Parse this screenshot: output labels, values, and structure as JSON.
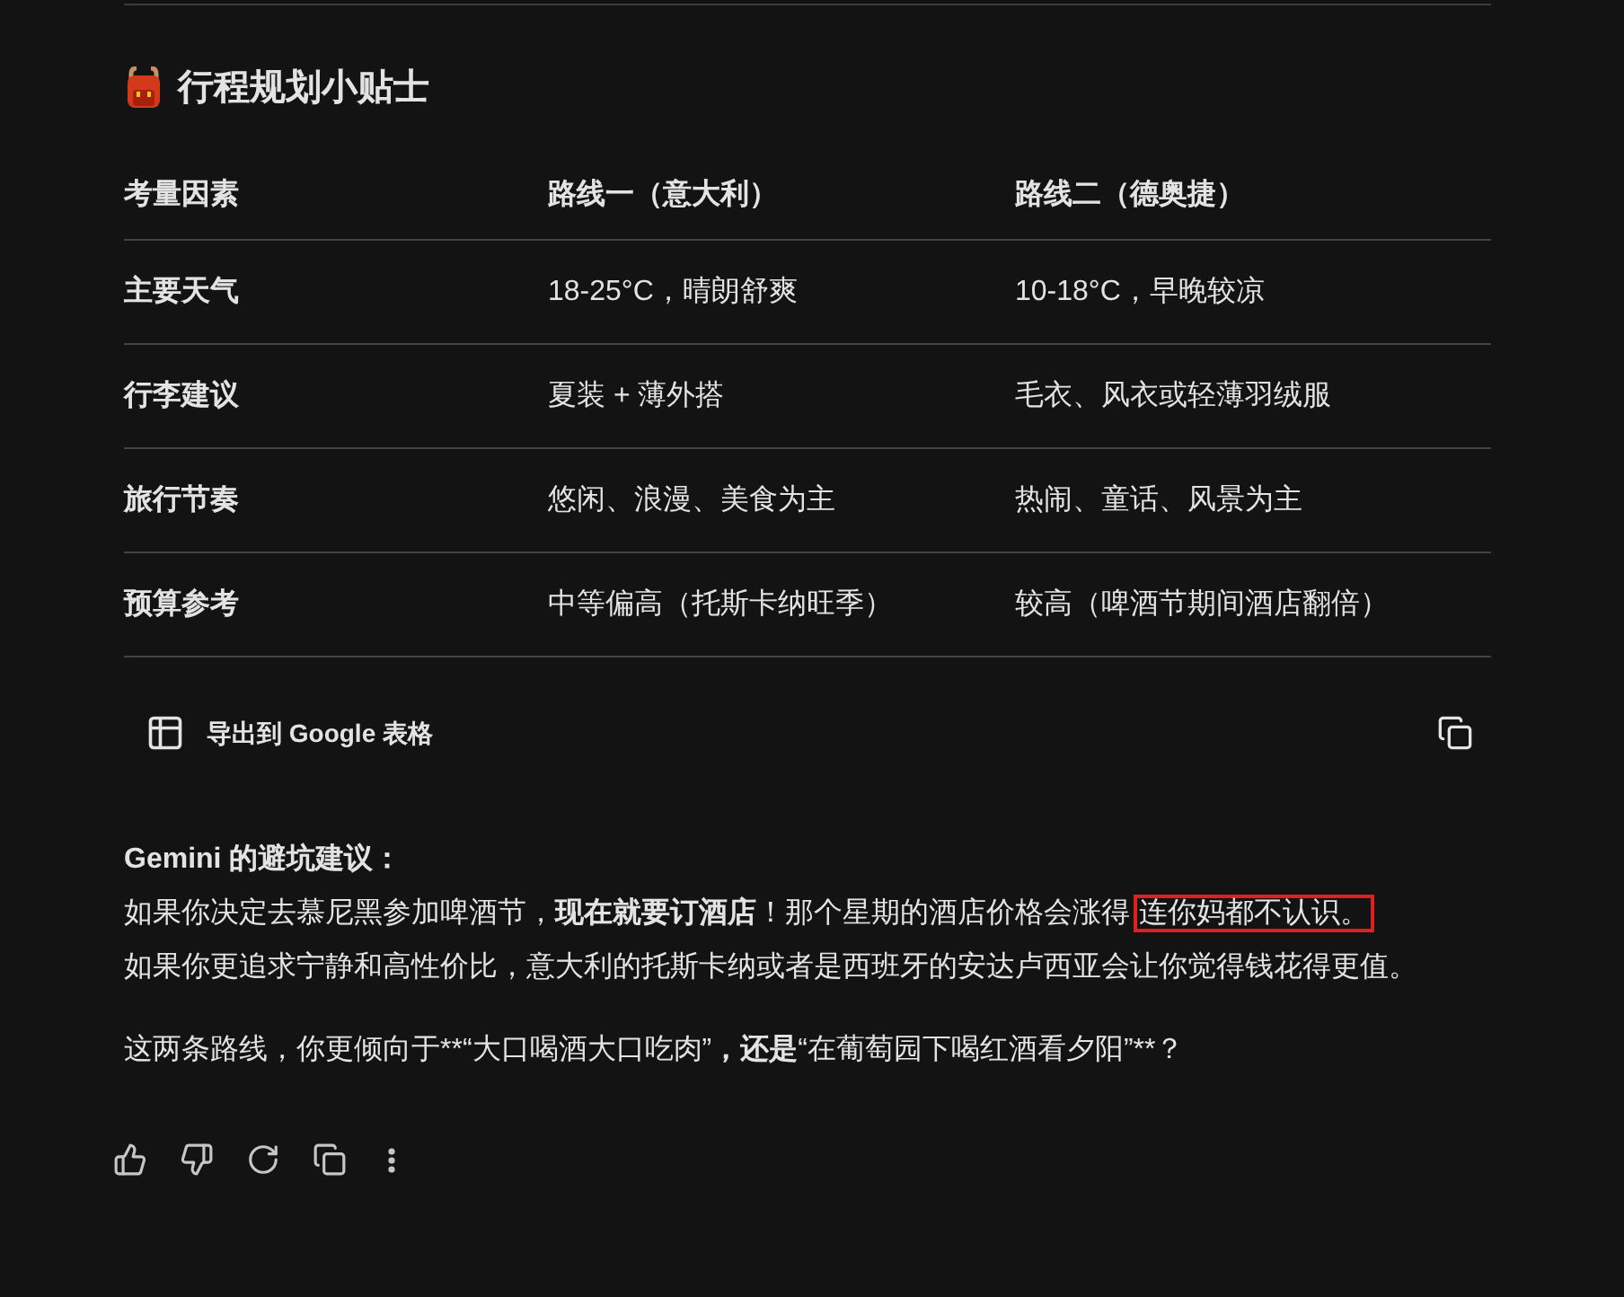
{
  "heading": {
    "title": "行程规划小贴士"
  },
  "table": {
    "columns": [
      "考量因素",
      "路线一（意大利）",
      "路线二（德奥捷）"
    ],
    "rows": [
      [
        "主要天气",
        "18-25°C，晴朗舒爽",
        "10-18°C，早晚较凉"
      ],
      [
        "行李建议",
        "夏装 + 薄外搭",
        "毛衣、风衣或轻薄羽绒服"
      ],
      [
        "旅行节奏",
        "悠闲、浪漫、美食为主",
        "热闹、童话、风景为主"
      ],
      [
        "预算参考",
        "中等偏高（托斯卡纳旺季）",
        "较高（啤酒节期间酒店翻倍）"
      ]
    ]
  },
  "export_button": {
    "label": "导出到 Google 表格"
  },
  "advice": {
    "title": "Gemini 的避坑建议：",
    "lines": [
      [
        {
          "text": "如果你决定去慕尼黑参加啤酒节，",
          "bold": false,
          "boxed": false
        },
        {
          "text": "现在就要订酒店",
          "bold": true,
          "boxed": false
        },
        {
          "text": "！那个星期的酒店价格会涨得",
          "bold": false,
          "boxed": false
        },
        {
          "text": "连你妈都不认识。",
          "bold": false,
          "boxed": true
        }
      ],
      [
        {
          "text": "如果你更追求宁静和高性价比，意大利的托斯卡纳或者是西班牙的安达卢西亚会让你觉得钱花得更值。",
          "bold": false,
          "boxed": false
        }
      ]
    ]
  },
  "question": {
    "segments": [
      {
        "text": "这两条路线，你更倾向于**“大口喝酒大口吃肉”",
        "bold": false,
        "boxed": false
      },
      {
        "text": "，还是",
        "bold": true,
        "boxed": false
      },
      {
        "text": "“在葡萄园下喝红酒看夕阳”**？",
        "bold": false,
        "boxed": false
      }
    ]
  }
}
